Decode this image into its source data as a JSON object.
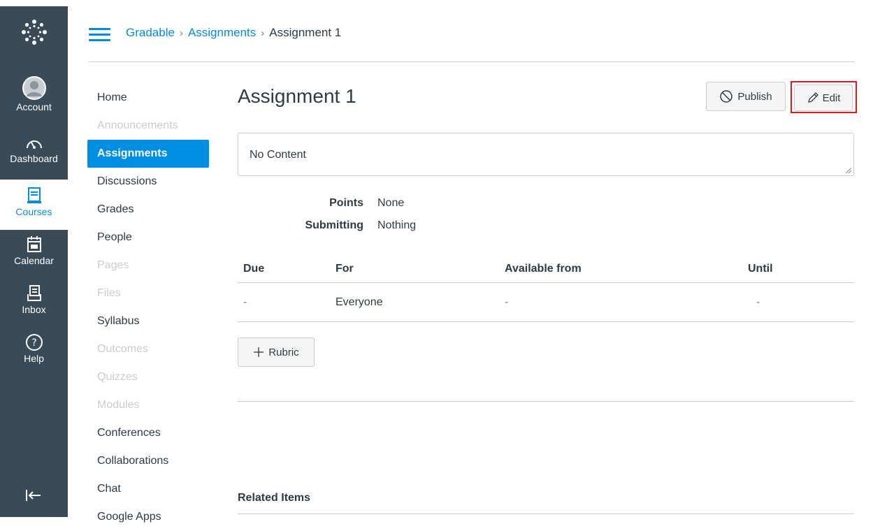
{
  "global_nav": {
    "items": [
      {
        "label": "Account",
        "icon": "avatar-icon"
      },
      {
        "label": "Dashboard",
        "icon": "dashboard-icon"
      },
      {
        "label": "Courses",
        "icon": "courses-icon"
      },
      {
        "label": "Calendar",
        "icon": "calendar-icon"
      },
      {
        "label": "Inbox",
        "icon": "inbox-icon"
      },
      {
        "label": "Help",
        "icon": "help-icon"
      }
    ]
  },
  "breadcrumb": {
    "items": [
      "Gradable",
      "Assignments",
      "Assignment 1"
    ],
    "separator": "›"
  },
  "course_nav": {
    "items": [
      {
        "label": "Home",
        "state": "enabled"
      },
      {
        "label": "Announcements",
        "state": "disabled"
      },
      {
        "label": "Assignments",
        "state": "active"
      },
      {
        "label": "Discussions",
        "state": "enabled"
      },
      {
        "label": "Grades",
        "state": "enabled"
      },
      {
        "label": "People",
        "state": "enabled"
      },
      {
        "label": "Pages",
        "state": "disabled"
      },
      {
        "label": "Files",
        "state": "disabled"
      },
      {
        "label": "Syllabus",
        "state": "enabled"
      },
      {
        "label": "Outcomes",
        "state": "disabled"
      },
      {
        "label": "Quizzes",
        "state": "disabled"
      },
      {
        "label": "Modules",
        "state": "disabled"
      },
      {
        "label": "Conferences",
        "state": "enabled"
      },
      {
        "label": "Collaborations",
        "state": "enabled"
      },
      {
        "label": "Chat",
        "state": "enabled"
      },
      {
        "label": "Google Apps",
        "state": "enabled"
      }
    ]
  },
  "assignment": {
    "title": "Assignment 1",
    "publish_label": "Publish",
    "edit_label": "Edit",
    "description": "No Content",
    "points_key": "Points",
    "points_value": "None",
    "submitting_key": "Submitting",
    "submitting_value": "Nothing"
  },
  "dates_table": {
    "headers": [
      "Due",
      "For",
      "Available from",
      "Until"
    ],
    "rows": [
      [
        "-",
        "Everyone",
        "-",
        "-"
      ]
    ]
  },
  "rubric_label": "Rubric",
  "related_items_label": "Related Items",
  "colors": {
    "brand": "#008ee2",
    "nav_bg": "#394b58",
    "highlight": "#e4161f"
  }
}
